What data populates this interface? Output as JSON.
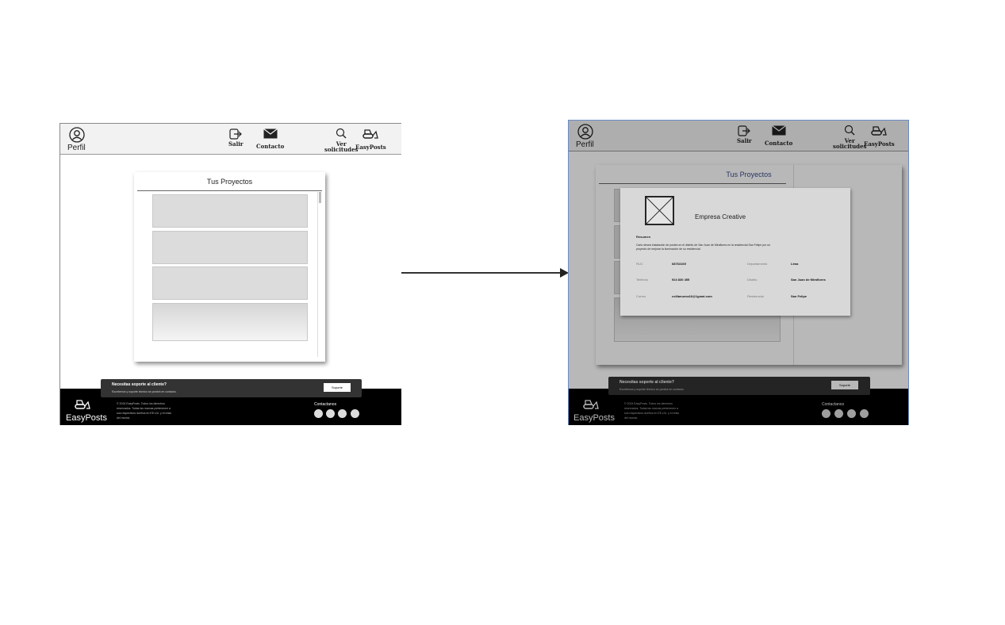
{
  "header": {
    "perfil_label": "Perfil",
    "nav": {
      "salir": "Salir",
      "contacto": "Contacto",
      "ver_line1": "Ver",
      "ver_line2": "solicitudes",
      "brand": "EasyPosts"
    }
  },
  "projects_card": {
    "title": "Tus Proyectos"
  },
  "footer": {
    "support_question": "Necesitas soporte al cliente?",
    "support_sub": "Escríbenos y soporte técnico se pondrá en contacto.",
    "support_button": "Soporte",
    "brand": "EasyPosts",
    "copyright_lines": [
      "© 2024 EasyPosts. Todos los derechos",
      "reservados. Todas las marcas pertenecen a",
      "sus respectivos dueños en EE.UU. y el resto",
      "del mundo."
    ],
    "contact_label": "Contactanos"
  },
  "modal": {
    "company": "Empresa Creative",
    "resumen_label": "Resumen",
    "description_lines": [
      "Carlo desea instalación de postes en el distrito de San Juan de Miraflores en la residencial San Felipe por un",
      "proyecto de mejorar la iluminación de su residencial."
    ],
    "fields": {
      "ruc_label": "RUC",
      "ruc_value": "68763169",
      "telefono_label": "Teléfono",
      "telefono_value": "924 830 455",
      "correo_label": "Correo",
      "correo_value": "cvillanueva16@1gmai.com",
      "departamento_label": "Departamento",
      "departamento_value": "Lima",
      "distrito_label": "Distrito",
      "distrito_value": "San Juan de Miraflores",
      "residencial_label": "Residencial",
      "residencial_value": "San Felipe"
    }
  }
}
